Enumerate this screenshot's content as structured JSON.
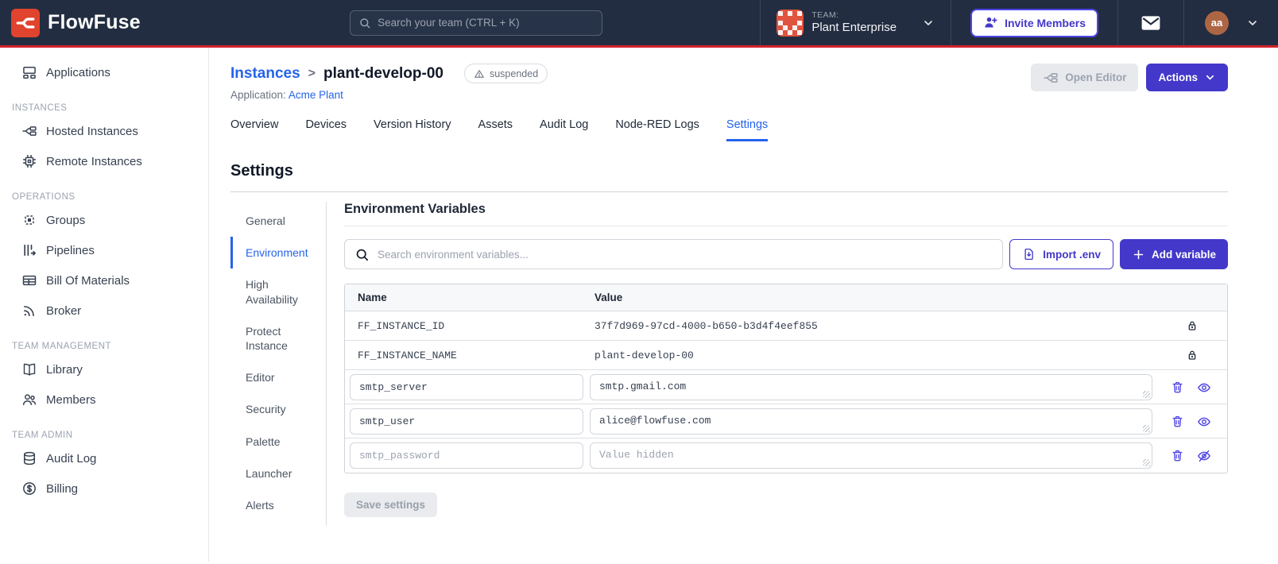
{
  "colors": {
    "navbar_bg": "#222d41",
    "accent_red": "#d2222d",
    "logo_red": "#e0432e",
    "indigo": "#4338ca",
    "link_blue": "#2563eb",
    "avatar_bg": "#ad6643"
  },
  "navbar": {
    "brand": "FlowFuse",
    "search_placeholder": "Search your team (CTRL + K)",
    "team": {
      "label": "TEAM:",
      "name": "Plant Enterprise"
    },
    "invite_button": "Invite Members",
    "avatar_initials": "aa"
  },
  "sidebar": {
    "sections": [
      {
        "label": "",
        "items": [
          {
            "label": "Applications",
            "icon": "applications-icon"
          }
        ]
      },
      {
        "label": "INSTANCES",
        "items": [
          {
            "label": "Hosted Instances",
            "icon": "hosted-instances-icon"
          },
          {
            "label": "Remote Instances",
            "icon": "remote-instances-icon"
          }
        ]
      },
      {
        "label": "OPERATIONS",
        "items": [
          {
            "label": "Groups",
            "icon": "groups-icon"
          },
          {
            "label": "Pipelines",
            "icon": "pipelines-icon"
          },
          {
            "label": "Bill Of Materials",
            "icon": "bill-of-materials-icon"
          },
          {
            "label": "Broker",
            "icon": "broker-icon"
          }
        ]
      },
      {
        "label": "TEAM MANAGEMENT",
        "items": [
          {
            "label": "Library",
            "icon": "library-icon"
          },
          {
            "label": "Members",
            "icon": "members-icon"
          }
        ]
      },
      {
        "label": "TEAM ADMIN",
        "items": [
          {
            "label": "Audit Log",
            "icon": "audit-log-icon"
          },
          {
            "label": "Billing",
            "icon": "billing-icon"
          }
        ]
      }
    ]
  },
  "header": {
    "breadcrumb_parent": "Instances",
    "breadcrumb_separator": ">",
    "instance_name": "plant-develop-00",
    "status_badge": "suspended",
    "application_label": "Application:",
    "application_name": "Acme Plant",
    "open_editor_button": "Open Editor",
    "actions_button": "Actions"
  },
  "tabs": [
    {
      "label": "Overview"
    },
    {
      "label": "Devices"
    },
    {
      "label": "Version History"
    },
    {
      "label": "Assets"
    },
    {
      "label": "Audit Log"
    },
    {
      "label": "Node-RED Logs"
    },
    {
      "label": "Settings",
      "active": true
    }
  ],
  "settings": {
    "title": "Settings",
    "nav": [
      {
        "label": "General"
      },
      {
        "label": "Environment",
        "active": true
      },
      {
        "label": "High Availability"
      },
      {
        "label": "Protect Instance"
      },
      {
        "label": "Editor"
      },
      {
        "label": "Security"
      },
      {
        "label": "Palette"
      },
      {
        "label": "Launcher"
      },
      {
        "label": "Alerts"
      }
    ],
    "environment": {
      "title": "Environment Variables",
      "search_placeholder": "Search environment variables...",
      "import_button": "Import .env",
      "add_button": "Add variable",
      "table": {
        "columns": [
          "Name",
          "Value"
        ],
        "locked_rows": [
          {
            "name": "FF_INSTANCE_ID",
            "value": "37f7d969-97cd-4000-b650-b3d4f4eef855"
          },
          {
            "name": "FF_INSTANCE_NAME",
            "value": "plant-develop-00"
          }
        ],
        "editable_rows": [
          {
            "name": "smtp_server",
            "value": "smtp.gmail.com",
            "hidden": false
          },
          {
            "name": "smtp_user",
            "value": "alice@flowfuse.com",
            "hidden": false
          },
          {
            "name": "smtp_password",
            "value": "",
            "value_placeholder": "Value hidden",
            "hidden": true
          }
        ]
      },
      "save_button": "Save settings"
    }
  }
}
